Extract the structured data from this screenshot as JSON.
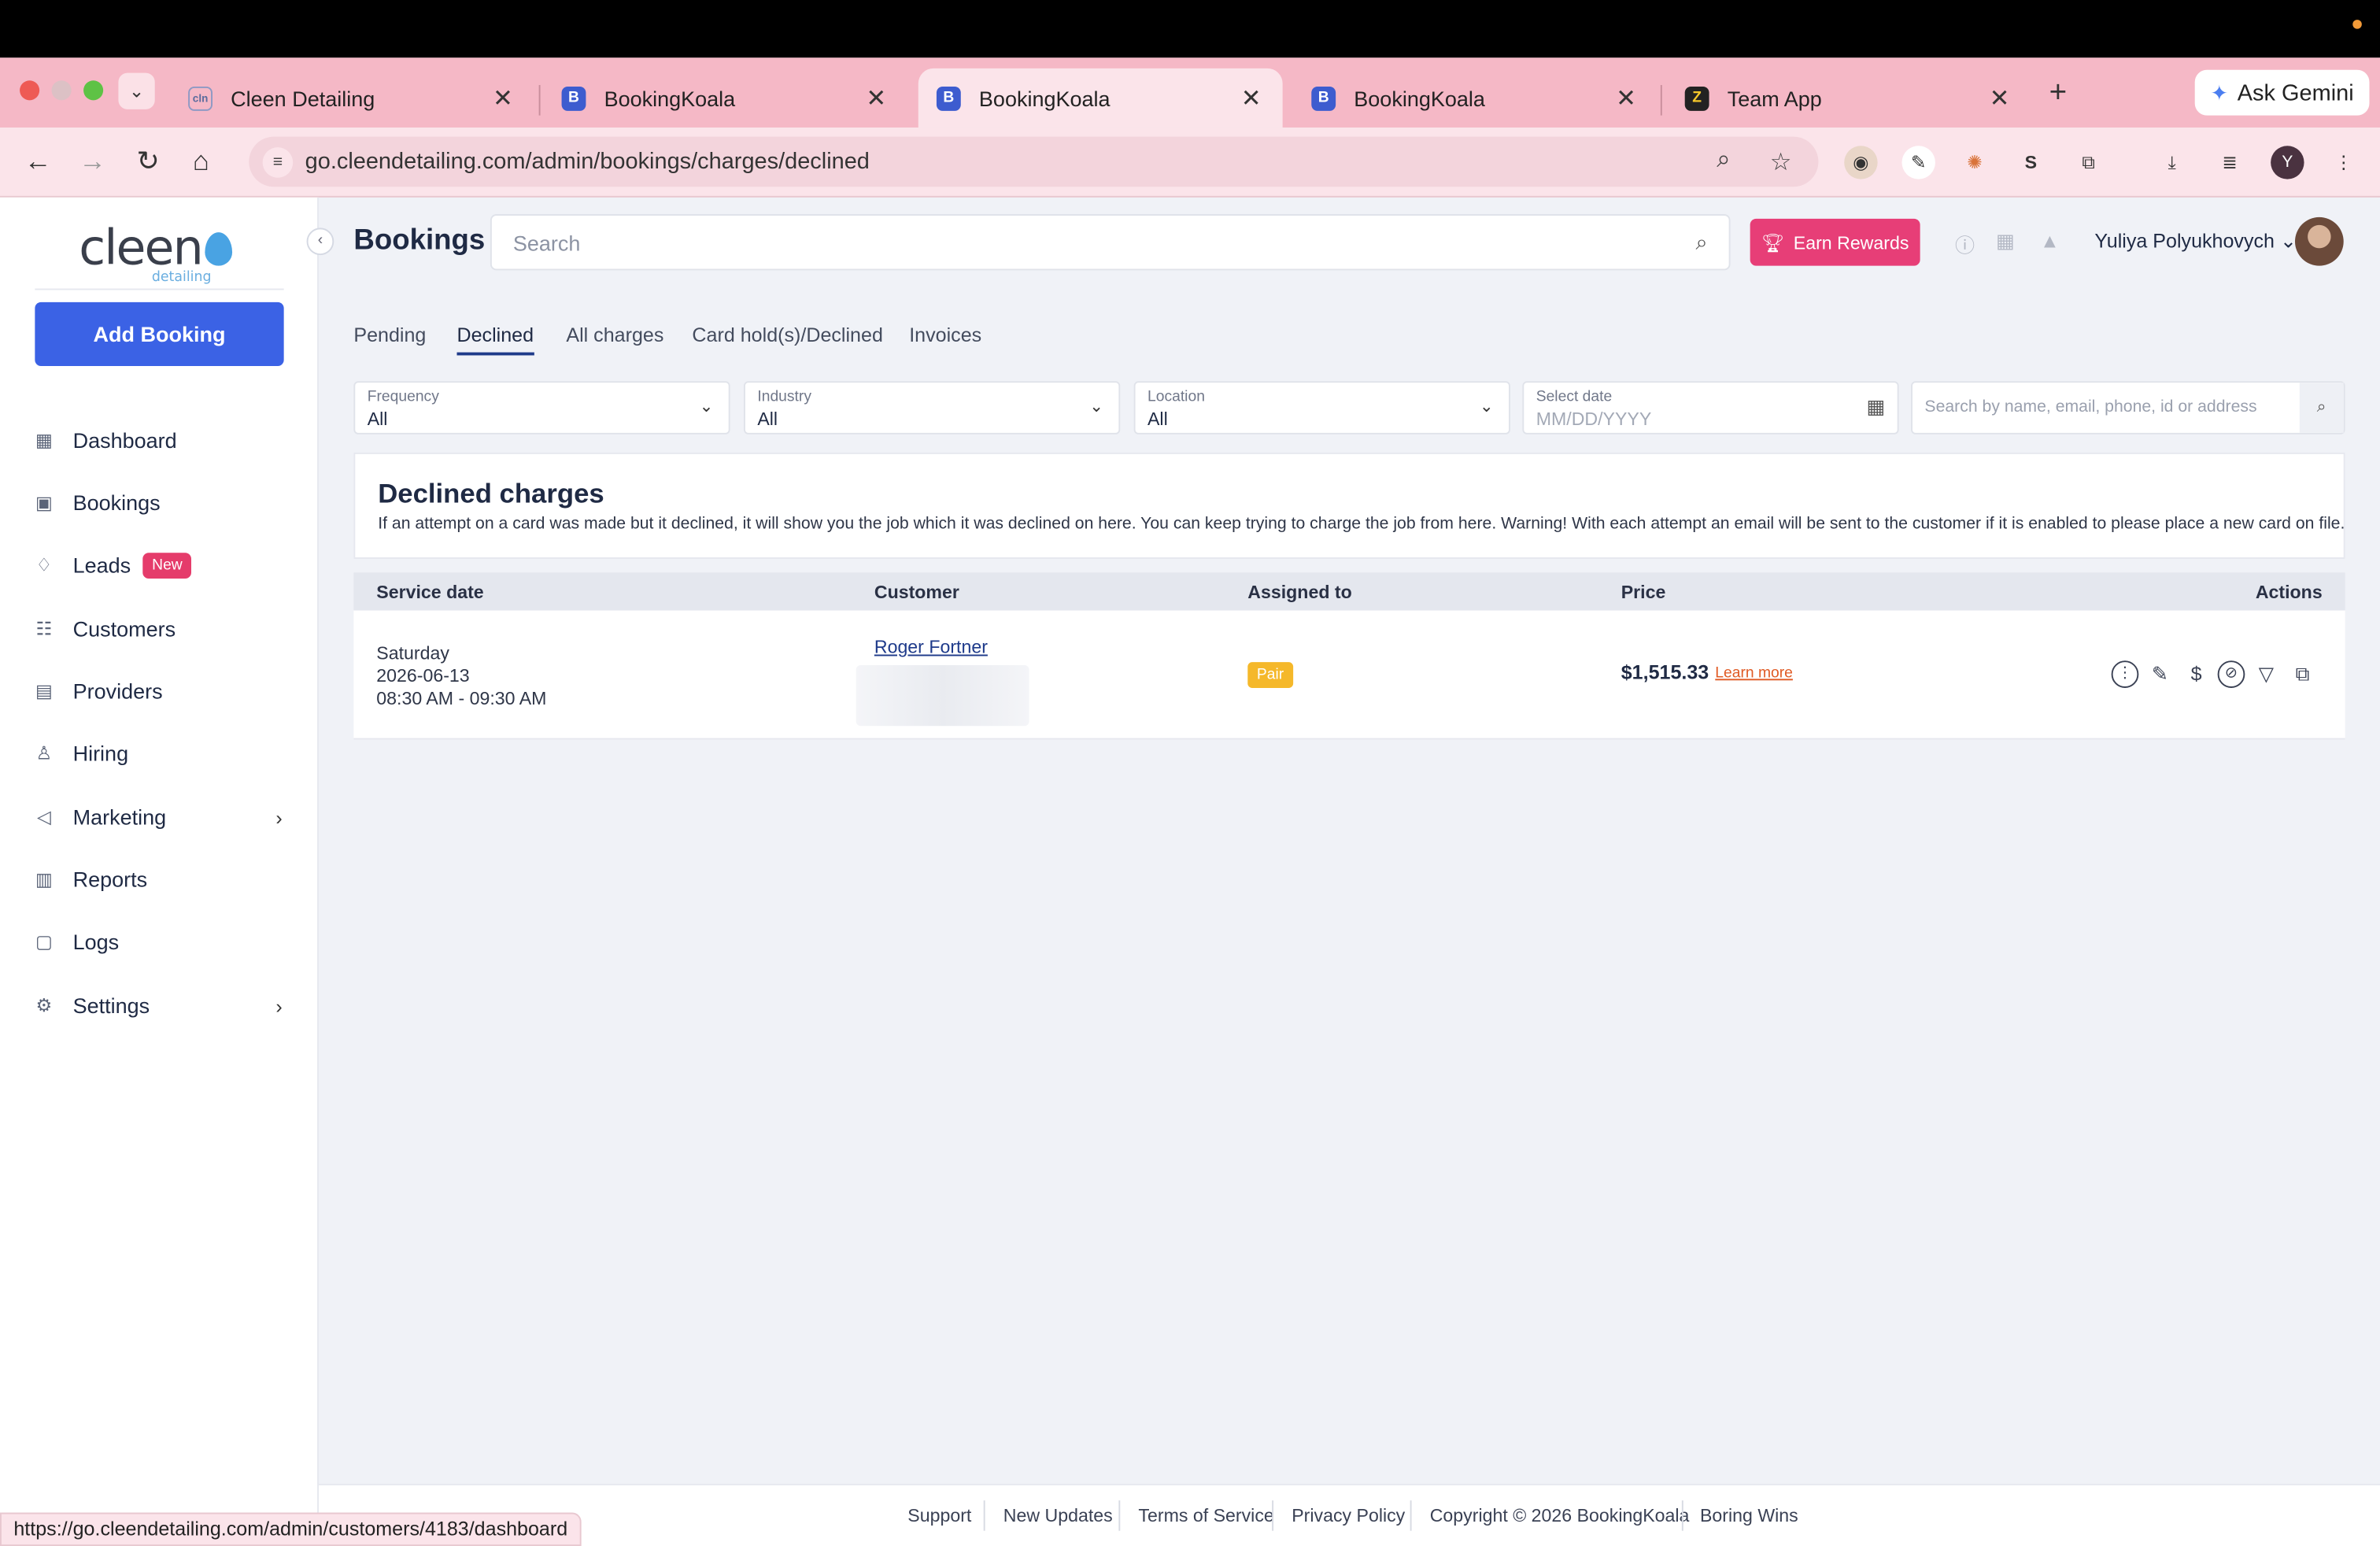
{
  "browser": {
    "tabs": [
      {
        "title": "Cleen Detailing",
        "favicon": "cleen-icon"
      },
      {
        "title": "BookingKoala",
        "favicon": "bookingkoala-icon"
      },
      {
        "title": "BookingKoala",
        "favicon": "bookingkoala-icon",
        "active": true
      },
      {
        "title": "BookingKoala",
        "favicon": "bookingkoala-icon"
      },
      {
        "title": "Team App",
        "favicon": "zapier-icon"
      }
    ],
    "gemini_label": "Ask Gemini",
    "url": "go.cleendetailing.com/admin/bookings/charges/declined",
    "profile_initial": "Y",
    "status_url": "https://go.cleendetailing.com/admin/customers/4183/dashboard"
  },
  "sidebar": {
    "logo_text": "cleen",
    "logo_sub": "detailing",
    "add_booking": "Add Booking",
    "items": [
      {
        "label": "Dashboard",
        "icon": "grid-icon"
      },
      {
        "label": "Bookings",
        "icon": "calendar-icon"
      },
      {
        "label": "Leads",
        "icon": "bell-icon",
        "badge": "New"
      },
      {
        "label": "Customers",
        "icon": "users-icon"
      },
      {
        "label": "Providers",
        "icon": "briefcase-icon"
      },
      {
        "label": "Hiring",
        "icon": "person-search-icon"
      },
      {
        "label": "Marketing",
        "icon": "megaphone-icon"
      },
      {
        "label": "Reports",
        "icon": "bar-chart-icon"
      },
      {
        "label": "Logs",
        "icon": "log-icon"
      },
      {
        "label": "Settings",
        "icon": "gear-icon"
      }
    ]
  },
  "header": {
    "title": "Bookings",
    "search_placeholder": "Search",
    "earn_rewards": "Earn Rewards",
    "user_name": "Yuliya Polyukhovych"
  },
  "subtabs": [
    "Pending",
    "Declined",
    "All charges",
    "Card hold(s)/Declined",
    "Invoices"
  ],
  "filters": {
    "frequency": {
      "label": "Frequency",
      "value": "All"
    },
    "industry": {
      "label": "Industry",
      "value": "All"
    },
    "location": {
      "label": "Location",
      "value": "All"
    },
    "date": {
      "label": "Select date",
      "placeholder": "MM/DD/YYYY"
    },
    "search_placeholder": "Search by name, email, phone, id or address"
  },
  "declined_card": {
    "title": "Declined charges",
    "description": "If an attempt on a card was made but it declined, it will show you the job which it was declined on here. You can keep trying to charge the job from here. Warning! With each attempt an email will be sent to the customer if it is enabled to please place a new card on file."
  },
  "table": {
    "columns": [
      "Service date",
      "Customer",
      "Assigned to",
      "Price",
      "Actions"
    ],
    "rows": [
      {
        "day": "Saturday",
        "date": "2026-06-13",
        "time": "08:30 AM - 09:30 AM",
        "customer": "Roger Fortner",
        "assigned": "Pair",
        "price": "$1,515.33",
        "learn_more": "Learn more"
      }
    ]
  },
  "footer": [
    "Support",
    "New Updates",
    "Terms of Service",
    "Privacy Policy",
    "Copyright © 2026 BookingKoala",
    "Boring Wins"
  ],
  "colors": {
    "primary": "#3b62e5",
    "accent_pink": "#e73e77",
    "badge_yellow": "#f5b82a",
    "tab_strip": "#f5b8c6"
  }
}
